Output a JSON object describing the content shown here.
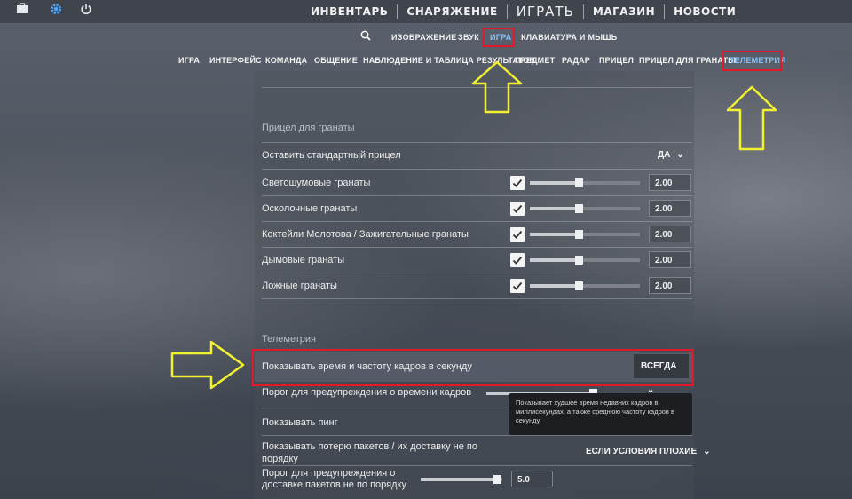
{
  "top_nav": {
    "items": [
      "ИНВЕНТАРЬ",
      "СНАРЯЖЕНИЕ",
      "ИГРАТЬ",
      "МАГАЗИН",
      "НОВОСТИ"
    ]
  },
  "settings_tabs": {
    "items": [
      "ИЗОБРАЖЕНИЕ",
      "ЗВУК",
      "ИГРА",
      "КЛАВИАТУРА И МЫШЬ"
    ],
    "active": "ИГРА"
  },
  "game_categories": {
    "items": [
      "ИГРА",
      "ИНТЕРФЕЙС",
      "КОМАНДА",
      "ОБЩЕНИЕ",
      "НАБЛЮДЕНИЕ И ТАБЛИЦА РЕЗУЛЬТАТОВ",
      "ПРЕДМЕТ",
      "РАДАР",
      "ПРИЦЕЛ",
      "ПРИЦЕЛ ДЛЯ ГРАНАТЫ",
      "ТЕЛЕМЕТРИЯ"
    ],
    "active": "ТЕЛЕМЕТРИЯ"
  },
  "grenade_crosshair": {
    "title": "Прицел для гранаты",
    "default_label": "Оставить стандартный прицел",
    "default_value": "ДА",
    "rows": [
      {
        "label": "Светошумовые гранаты",
        "checked": true,
        "level": 0.41,
        "value": "2.00"
      },
      {
        "label": "Осколочные гранаты",
        "checked": true,
        "level": 0.41,
        "value": "2.00"
      },
      {
        "label": "Коктейли Молотова / Зажигательные гранаты",
        "checked": true,
        "level": 0.41,
        "value": "2.00"
      },
      {
        "label": "Дымовые гранаты",
        "checked": true,
        "level": 0.41,
        "value": "2.00"
      },
      {
        "label": "Ложные гранаты",
        "checked": true,
        "level": 0.41,
        "value": "2.00"
      }
    ]
  },
  "telemetry": {
    "title": "Телеметрия",
    "fps_label": "Показывать время и частоту кадров в секунду",
    "fps_value": "ВСЕГДА",
    "frametime_warning_label": "Порог для предупреждения о времени кадров",
    "ping_label": "Показывать пинг",
    "packet_loss_label": "Показывать потерю пакетов / их доставку не по порядку",
    "packet_loss_value": "ЕСЛИ УСЛОВИЯ ПЛОХИЕ",
    "reorder_warning_label": "Порог для предупреждения о доставке пакетов не по порядку",
    "reorder_value": "5.0"
  },
  "tooltip": {
    "text": "Показывает худшее время недавних кадров в миллисекундах, а также среднюю частоту кадров в секунду."
  },
  "icons": {
    "inventory": "briefcase-icon",
    "settings": "gear-icon",
    "power": "power-icon",
    "search": "search-icon"
  },
  "colors": {
    "highlight_box": "#e0192b",
    "annotation_arrow": "#f3f230",
    "active_tab_text": "#7fc3ff"
  }
}
